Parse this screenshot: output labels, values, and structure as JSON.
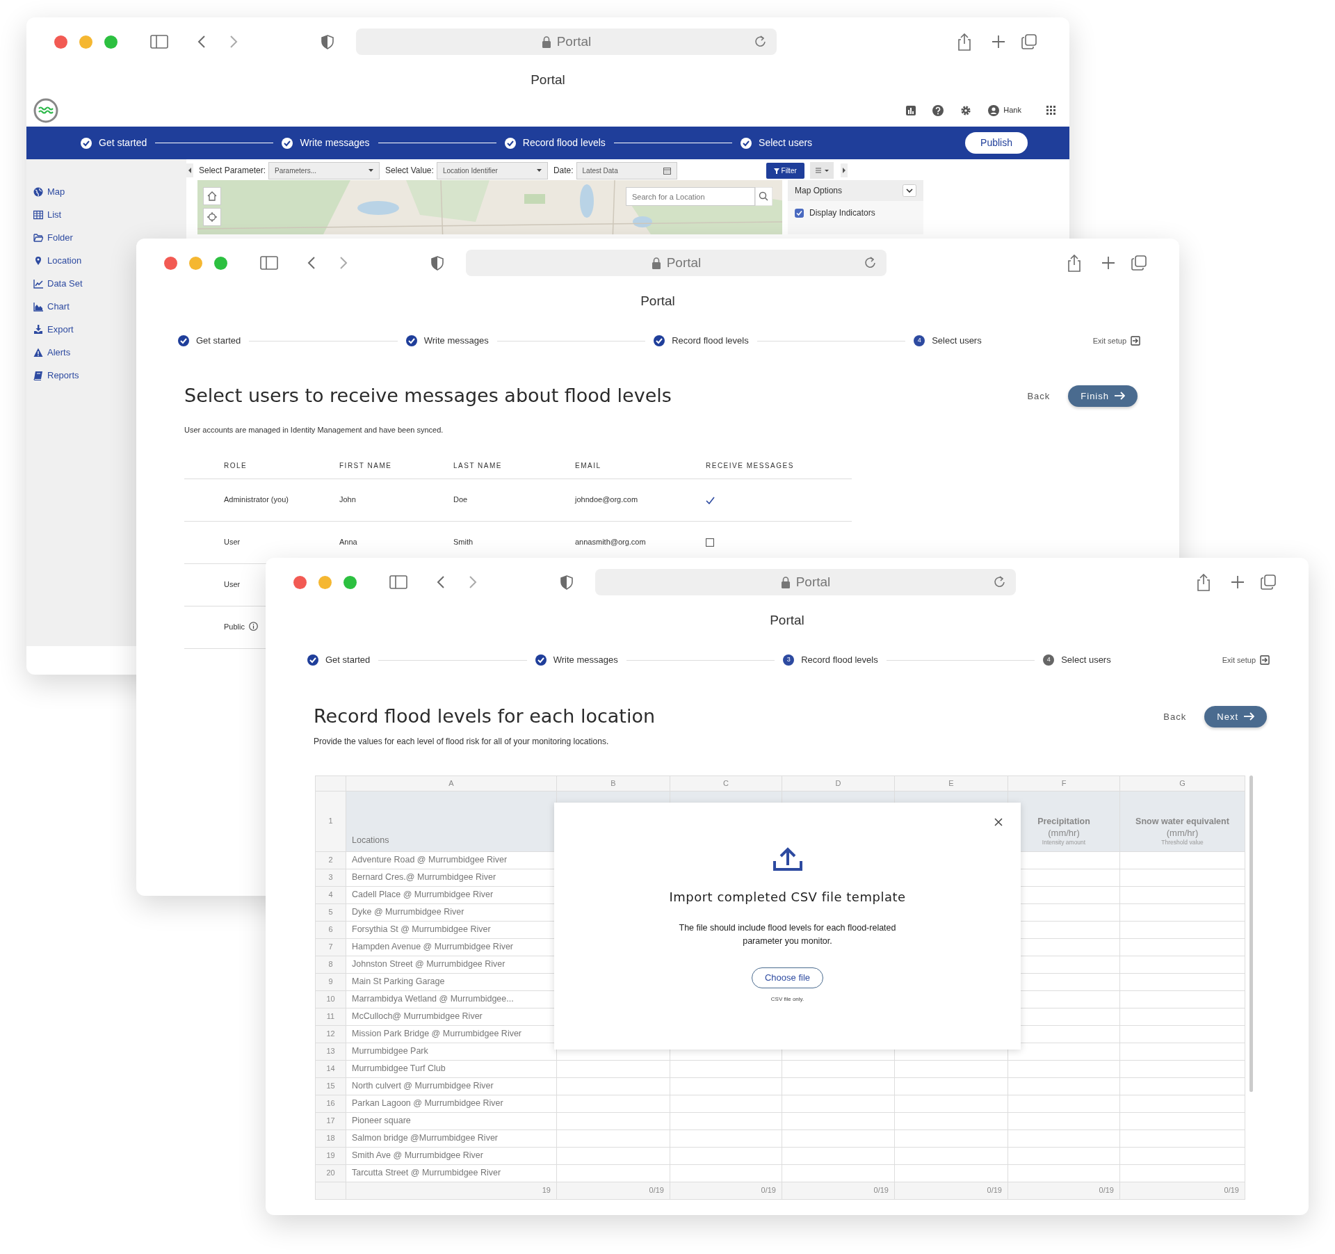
{
  "map_window": {
    "browser": {
      "address": "Portal",
      "title": "Portal"
    },
    "app_header": {
      "user": "Hank"
    },
    "stepper": {
      "steps": [
        {
          "label": "Get started",
          "done": true,
          "current": false
        },
        {
          "label": "Write messages",
          "done": true,
          "current": false
        },
        {
          "label": "Record flood levels",
          "done": true,
          "current": false
        },
        {
          "label": "Select users",
          "done": true,
          "current": false
        }
      ],
      "action": "Publish"
    },
    "filters": [
      {
        "label": "Select Parameter:",
        "value": "Parameters...",
        "kind": "select"
      },
      {
        "label": "Select Value:",
        "value": "Location Identifier",
        "kind": "select"
      },
      {
        "label": "Date:",
        "value": "Latest Data",
        "kind": "date"
      }
    ],
    "filter_button": "Filter",
    "map": {
      "kind": "picture",
      "search_placeholder": "Search for a Location"
    },
    "map_options": {
      "title": "Map Options",
      "options": [
        {
          "label": "Display Indicators",
          "checked": true
        }
      ]
    },
    "sidebar": {
      "items": [
        {
          "label": "Map"
        },
        {
          "label": "List"
        },
        {
          "label": "Folder"
        },
        {
          "label": "Location"
        },
        {
          "label": "Data Set"
        },
        {
          "label": "Chart"
        },
        {
          "label": "Export"
        },
        {
          "label": "Alerts"
        },
        {
          "label": "Reports"
        }
      ]
    }
  },
  "users_window": {
    "browser": {
      "address": "Portal",
      "title": "Portal"
    },
    "stepper": {
      "steps": [
        {
          "label": "Get started",
          "done": true,
          "current": false
        },
        {
          "label": "Write messages",
          "done": true,
          "current": false
        },
        {
          "label": "Record flood levels",
          "done": true,
          "current": false
        },
        {
          "label": "Select users",
          "done": false,
          "current": true,
          "number": "4"
        }
      ],
      "exit": "Exit setup"
    },
    "title": "Select users to receive messages about flood levels",
    "back": "Back",
    "primary": "Finish",
    "note": "User accounts are managed in Identity Management and have been synced.",
    "table": {
      "columns": [
        "ROLE",
        "FIRST NAME",
        "LAST NAME",
        "EMAIL",
        "RECEIVE MESSAGES"
      ],
      "rows": [
        {
          "kind": "admin",
          "role": "Administrator (you)",
          "first_name": "John",
          "last_name": "Doe",
          "email": "johndoe@org.com",
          "receive": true
        },
        {
          "kind": "user",
          "role": "User",
          "first_name": "Anna",
          "last_name": "Smith",
          "email": "annasmith@org.com",
          "receive": false
        },
        {
          "kind": "user",
          "role": "User"
        },
        {
          "kind": "public",
          "role": "Public"
        }
      ]
    }
  },
  "levels_window": {
    "browser": {
      "address": "Portal",
      "title": "Portal"
    },
    "stepper": {
      "steps": [
        {
          "label": "Get started",
          "done": true,
          "current": false
        },
        {
          "label": "Write messages",
          "done": true,
          "current": false
        },
        {
          "label": "Record flood levels",
          "done": false,
          "current": true,
          "number": "3"
        },
        {
          "label": "Select users",
          "done": false,
          "current": false,
          "number": "4"
        }
      ],
      "exit": "Exit setup"
    },
    "title": "Record flood levels for each location",
    "back": "Back",
    "primary": "Next",
    "subtitle": "Provide the values for each level of flood risk for all of your monitoring locations.",
    "sheet": {
      "header_row_number": "1",
      "columns": [
        {
          "letter": "A",
          "title": "Locations"
        },
        {
          "letter": "B"
        },
        {
          "letter": "C"
        },
        {
          "letter": "D"
        },
        {
          "letter": "E"
        },
        {
          "letter": "F",
          "title": "Precipitation",
          "unit": "(mm/hr)",
          "note": "Intensity amount"
        },
        {
          "letter": "G",
          "title": "Snow water equivalent",
          "unit": "(mm/hr)",
          "note": "Threshold value"
        }
      ],
      "rows": [
        {
          "number": "2",
          "location": "Adventure Road @ Murrumbidgee River"
        },
        {
          "number": "3",
          "location": "Bernard Cres.@ Murrumbidgee River"
        },
        {
          "number": "4",
          "location": "Cadell Place @ Murrumbidgee River"
        },
        {
          "number": "5",
          "location": "Dyke @ Murrumbidgee River"
        },
        {
          "number": "6",
          "location": "Forsythia St @ Murrumbidgee River"
        },
        {
          "number": "7",
          "location": "Hampden Avenue @ Murrumbidgee River"
        },
        {
          "number": "8",
          "location": "Johnston Street @ Murrumbidgee River"
        },
        {
          "number": "9",
          "location": "Main St Parking Garage"
        },
        {
          "number": "10",
          "location": "Marrambidya Wetland @ Murrumbidgee..."
        },
        {
          "number": "11",
          "location": "McCulloch@ Murrumbidgee River"
        },
        {
          "number": "12",
          "location": "Mission Park Bridge @ Murrumbidgee River"
        },
        {
          "number": "13",
          "location": "Murrumbidgee Park"
        },
        {
          "number": "14",
          "location": "Murrumbidgee Turf Club"
        },
        {
          "number": "15",
          "location": "North culvert @ Murrumbidgee River"
        },
        {
          "number": "16",
          "location": "Parkan Lagoon @ Murrumbidgee River"
        },
        {
          "number": "17",
          "location": "Pioneer square"
        },
        {
          "number": "18",
          "location": "Salmon bridge @Murrumbidgee River"
        },
        {
          "number": "19",
          "location": "Smith Ave @ Murrumbidgee River"
        },
        {
          "number": "20",
          "location": "Tarcutta Street @ Murrumbidgee River"
        }
      ],
      "totals": [
        "19",
        "0/19",
        "0/19",
        "0/19",
        "0/19",
        "0/19",
        "0/19"
      ]
    },
    "modal": {
      "title": "Import completed CSV file template",
      "text": "The file should include flood levels for each flood-related parameter you monitor.",
      "button": "Choose file",
      "hint": "CSV file only."
    }
  }
}
